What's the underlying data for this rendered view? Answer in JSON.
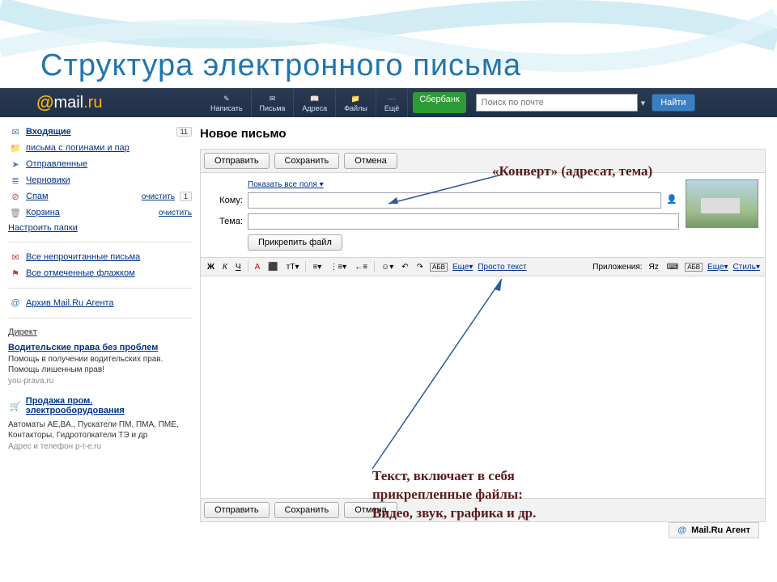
{
  "slide_title": "Структура электронного письма",
  "logo": {
    "mail": "mail",
    "ru": ".ru"
  },
  "topnav": {
    "items": [
      "Написать",
      "Письма",
      "Адреса",
      "Файлы",
      "Ещё"
    ],
    "sberbank": "Сбербанк"
  },
  "search": {
    "placeholder": "Поиск по почте",
    "button": "Найти"
  },
  "sidebar": {
    "inbox": {
      "label": "Входящие",
      "count": "11"
    },
    "logins": {
      "label": "письма с логинами и пар"
    },
    "sent": {
      "label": "Отправленные"
    },
    "drafts": {
      "label": "Черновики"
    },
    "spam": {
      "label": "Спам",
      "action": "очистить",
      "count": "1"
    },
    "trash": {
      "label": "Корзина",
      "action": "очистить"
    },
    "settings": "Настроить папки",
    "unread": "Все непрочитанные письма",
    "flagged": "Все отмеченные флажком",
    "archive": "Архив Mail.Ru Агента",
    "direkt": "Директ",
    "ad1": {
      "title": "Водительские права без проблем",
      "text": "Помощь в получении водительских прав. Помощь лишенным прав!",
      "url": "you-prava.ru"
    },
    "ad2": {
      "title": "Продажа пром. электрооборудования",
      "text": "Автоматы АЕ,ВА., Пускатели ПМ, ПМА, ПМЕ, Контакторы, Гидротолкатели ТЭ и др",
      "url": "Адрес и телефон  p-t-e.ru"
    }
  },
  "compose": {
    "title": "Новое письмо",
    "send": "Отправить",
    "save": "Сохранить",
    "cancel": "Отмена",
    "show_all": "Показать все поля",
    "to": "Кому:",
    "subject": "Тема:",
    "attach": "Прикрепить файл"
  },
  "toolbar": {
    "bold": "Ж",
    "italic": "К",
    "underline": "Ч",
    "more1": "Еще",
    "plaintext": "Просто текст",
    "apps": "Приложения:",
    "more2": "Еще",
    "style": "Стиль"
  },
  "agent_bar": "Mail.Ru Агент",
  "annotations": {
    "envelope": "«Конверт» (адресат, тема)",
    "body": "Текст, включает в себя\nприкрепленные файлы:\nВидео, звук, графика и др."
  }
}
